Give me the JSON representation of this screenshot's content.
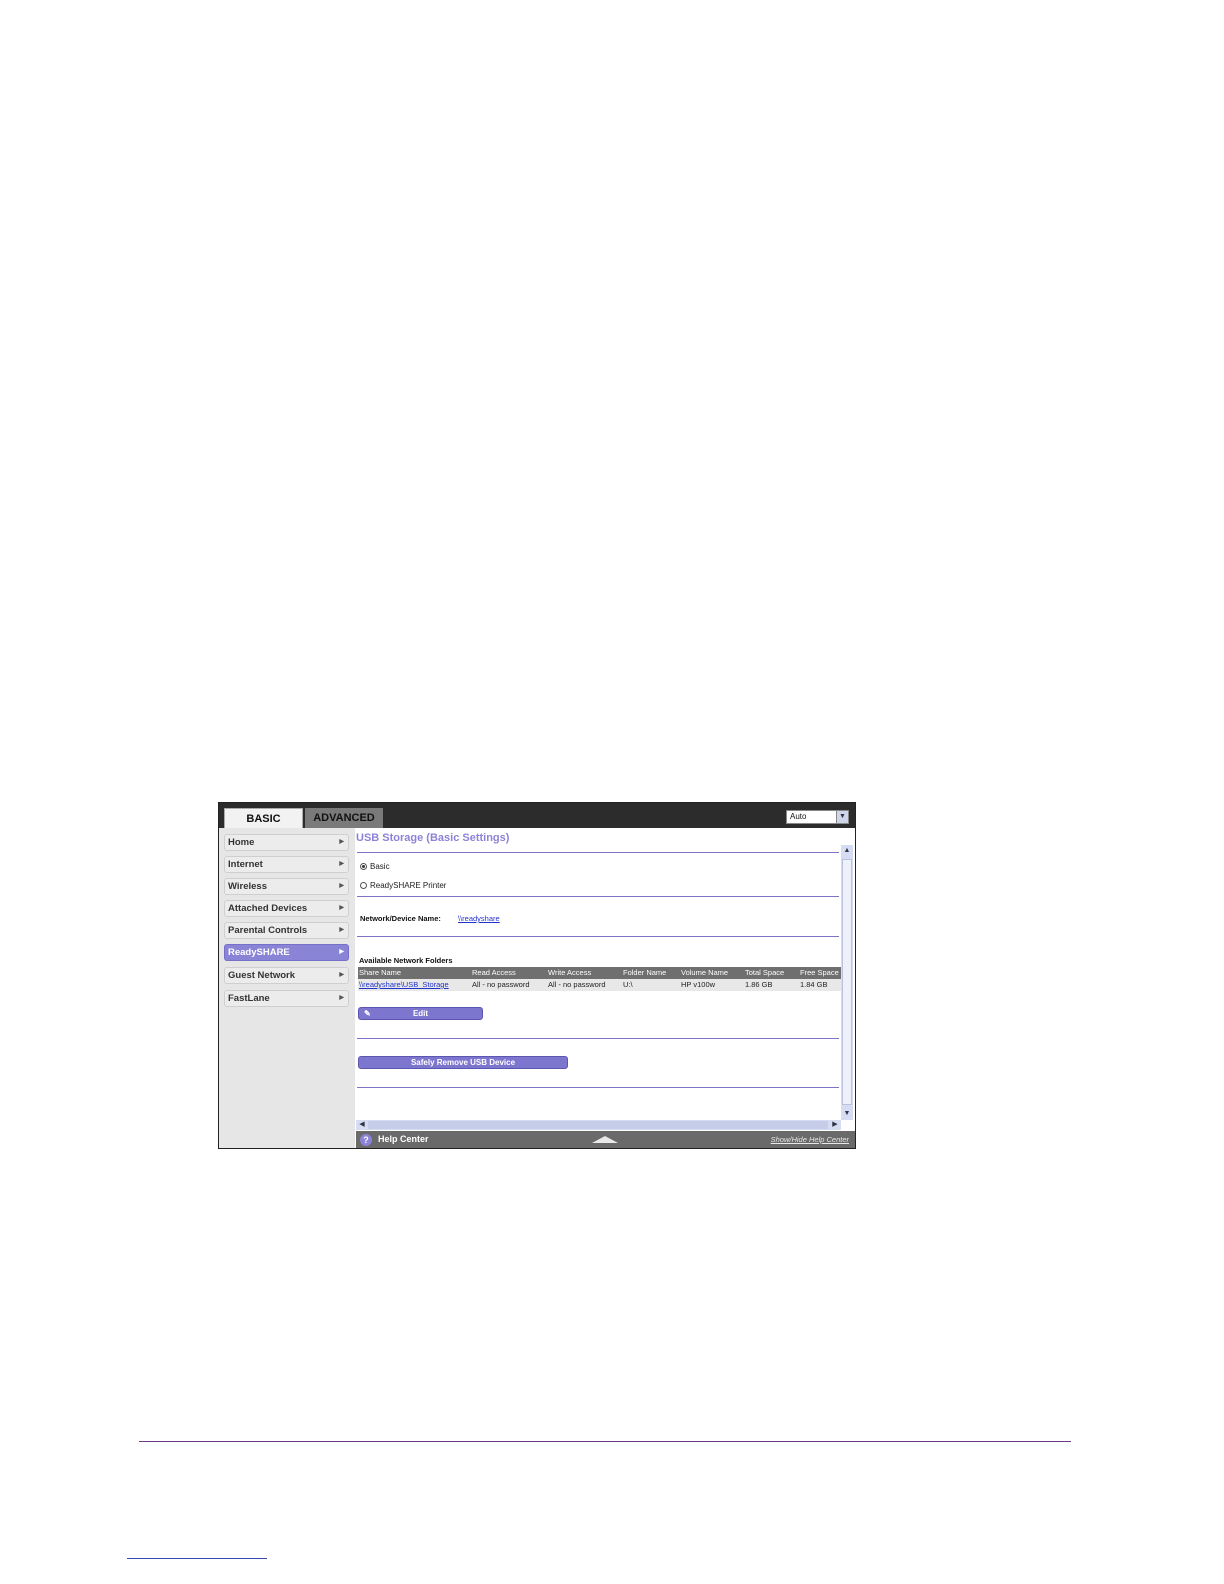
{
  "tabs": {
    "basic": "BASIC",
    "advanced": "ADVANCED"
  },
  "language": {
    "selected": "Auto"
  },
  "sidebar": {
    "items": [
      {
        "label": "Home"
      },
      {
        "label": "Internet"
      },
      {
        "label": "Wireless"
      },
      {
        "label": "Attached Devices"
      },
      {
        "label": "Parental Controls"
      },
      {
        "label": "ReadySHARE"
      },
      {
        "label": "Guest Network"
      },
      {
        "label": "FastLane"
      }
    ],
    "active": "ReadySHARE"
  },
  "page": {
    "title": "USB Storage (Basic Settings)",
    "options": {
      "basic": "Basic",
      "printer": "ReadySHARE Printer"
    },
    "selected_option": "Basic",
    "device_name_label": "Network/Device Name:",
    "device_name_value": "\\\\readyshare",
    "folders_label": "Available Network Folders"
  },
  "table": {
    "headers": [
      "Share Name",
      "Read Access",
      "Write Access",
      "Folder Name",
      "Volume Name",
      "Total Space",
      "Free Space"
    ],
    "rows": [
      [
        "\\\\readyshare\\USB_Storage",
        "All - no password",
        "All - no password",
        "U:\\",
        "HP v100w",
        "1.86 GB",
        "1.84 GB"
      ]
    ]
  },
  "buttons": {
    "edit": "Edit",
    "remove": "Safely Remove USB Device"
  },
  "help": {
    "label": "Help Center",
    "toggle": "Show/Hide Help Center"
  },
  "colors": {
    "accent": "#8c83d8",
    "nav_active": "#8a84d6",
    "topbar": "#2c2c2c",
    "rule": "#7c74c8"
  }
}
